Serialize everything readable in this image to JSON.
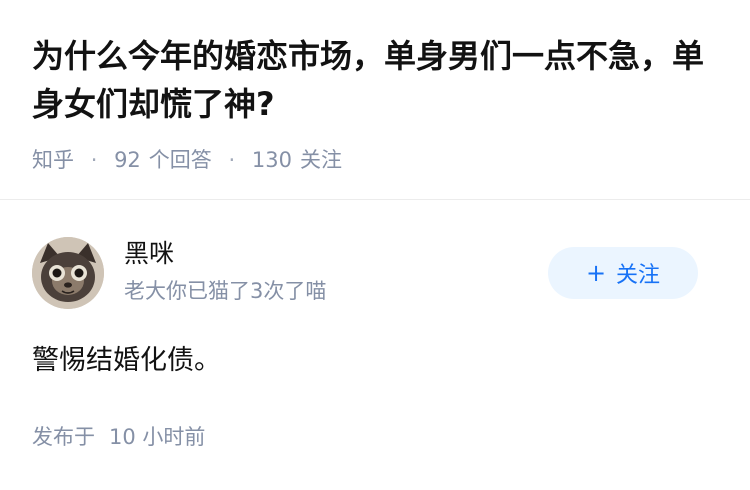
{
  "question": {
    "title": "为什么今年的婚恋市场，单身男们一点不急，单身女们却慌了神?",
    "meta": {
      "source": "知乎",
      "answers_count": "92",
      "answers_label": "个回答",
      "followers_count": "130",
      "followers_label": "关注"
    }
  },
  "answer": {
    "author": {
      "name": "黑咪",
      "bio": "老大你已猫了3次了喵",
      "avatar_icon": "cat-avatar-icon"
    },
    "follow_button": {
      "icon": "plus-icon",
      "label": "关注"
    },
    "content": "警惕结婚化债。",
    "publish": {
      "label": "发布于",
      "time": "10 小时前"
    }
  },
  "colors": {
    "title": "#121212",
    "meta": "#8590a6",
    "accent": "#1772f6",
    "button_bg": "#ebf5ff",
    "divider": "#ececec"
  }
}
